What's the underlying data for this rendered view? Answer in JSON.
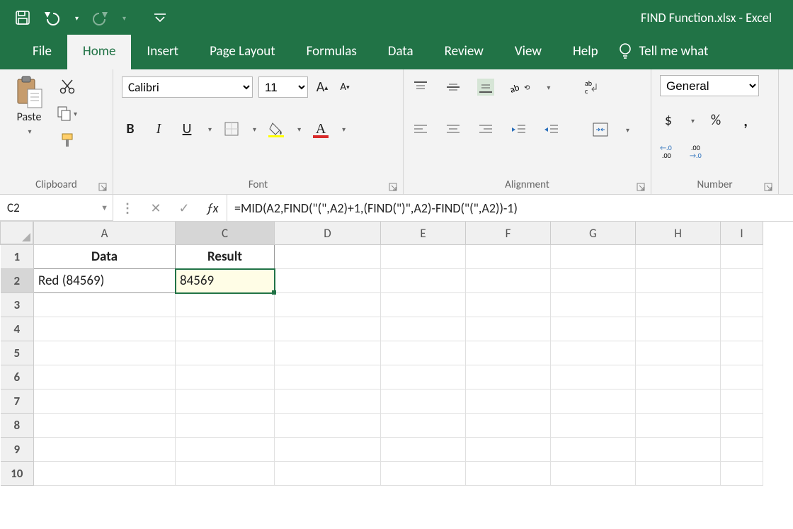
{
  "title": "FIND Function.xlsx  -  Excel",
  "tabs": {
    "file": "File",
    "home": "Home",
    "insert": "Insert",
    "pagelayout": "Page Layout",
    "formulas": "Formulas",
    "data": "Data",
    "review": "Review",
    "view": "View",
    "help": "Help",
    "tellme": "Tell me what"
  },
  "clipboard": {
    "paste": "Paste",
    "label": "Clipboard"
  },
  "font": {
    "name": "Calibri",
    "size": "11",
    "label": "Font",
    "bold": "B",
    "italic": "I",
    "underline": "U",
    "growA": "A",
    "shrinkA": "A",
    "colorA": "A"
  },
  "alignment": {
    "label": "Alignment",
    "wrap": "ab\nc↩"
  },
  "number": {
    "label": "Number",
    "format": "General",
    "dollar": "$",
    "percent": "%",
    "comma": ",",
    "incdec": "←.0\n.00",
    "decdec": ".00\n→.0"
  },
  "namebox": "C2",
  "formula": "=MID(A2,FIND(\"(\",A2)+1,(FIND(\")\",A2)-FIND(\"(\",A2))-1)",
  "columns": [
    "A",
    "C",
    "D",
    "E",
    "F",
    "G",
    "H",
    "I"
  ],
  "rows": [
    "1",
    "2",
    "3",
    "4",
    "5",
    "6",
    "7",
    "8",
    "9",
    "10"
  ],
  "cells": {
    "A1": "Data",
    "C1": "Result",
    "A2": "Red (84569)",
    "C2": "84569"
  }
}
